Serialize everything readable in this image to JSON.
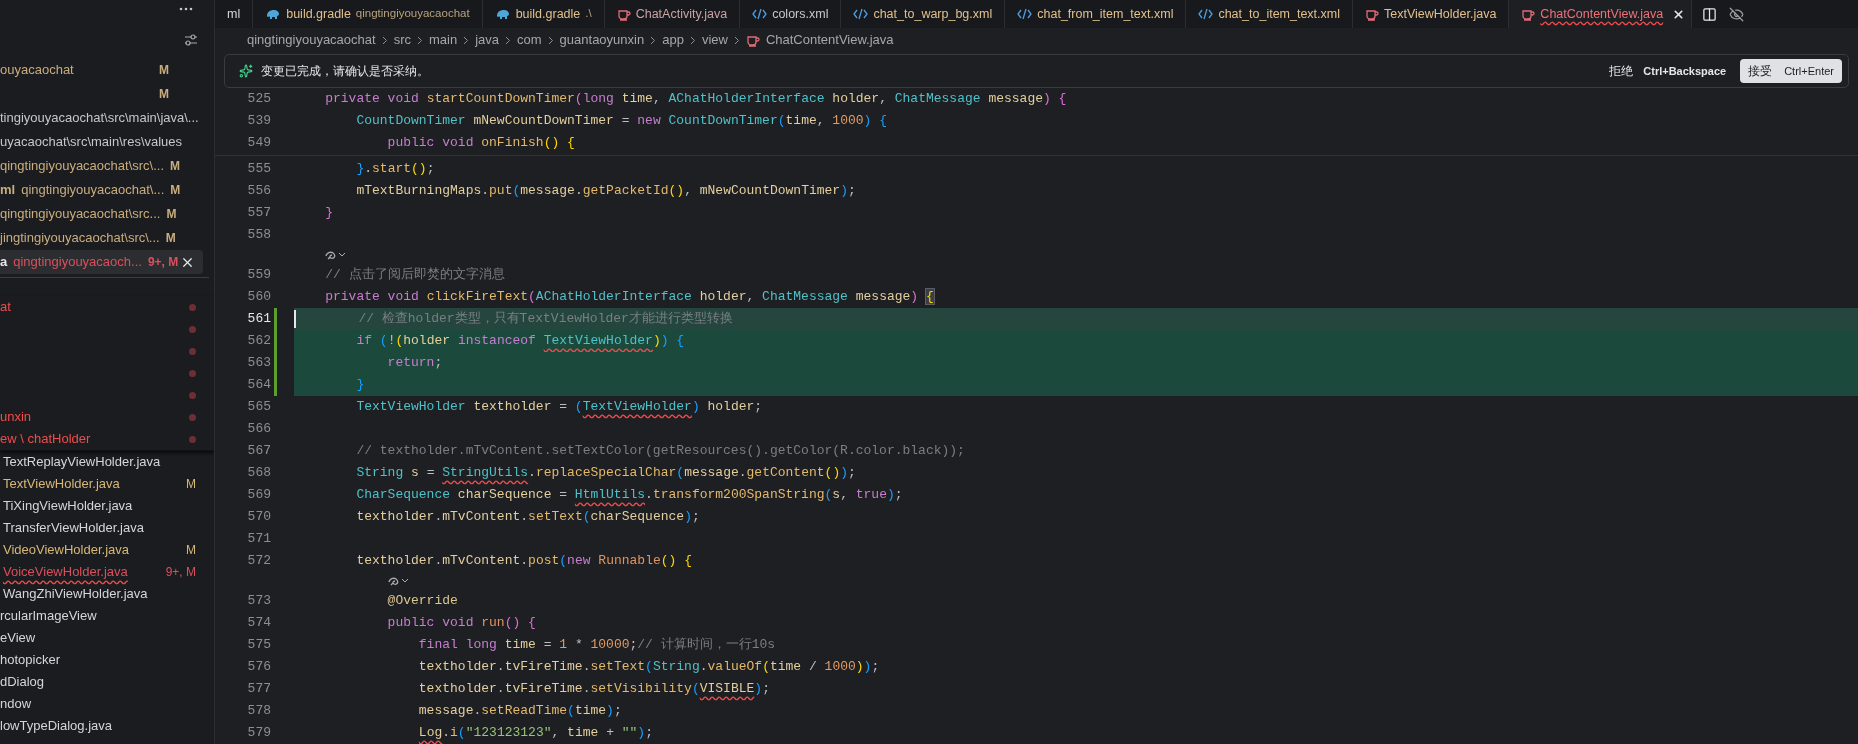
{
  "sidebar": {
    "editors": [
      {
        "path": "ouyacaochat",
        "badge": "M",
        "color": "#c9ad7f",
        "selected": false
      },
      {
        "badge": "M",
        "color": "#c9ad7f",
        "selected": false
      },
      {
        "path": "tingiyouyacaochat\\src\\main\\java\\...",
        "color": "#c5c7cb",
        "selected": false
      },
      {
        "path": "uyacaochat\\src\\main\\res\\values",
        "color": "#c5c7cb",
        "selected": false
      },
      {
        "path": "qingtingiyouyacaochat\\src\\...",
        "badge": "M",
        "color": "#c9ad7f",
        "selected": false
      },
      {
        "name": "ml",
        "path": "qingtingiyouyacaochat\\...",
        "badge": "M",
        "color": "#c9ad7f",
        "selected": false
      },
      {
        "path": "qingtingiyouyacaochat\\src...",
        "badge": "M",
        "color": "#c9ad7f",
        "selected": false
      },
      {
        "path": "jingtingiyouyacaochat\\src\\...",
        "badge": "M",
        "color": "#c9ad7f",
        "selected": false
      },
      {
        "name": "a",
        "path": "qingtingiyouyacaoch...",
        "badge": "9+, M",
        "color": "#d9505c",
        "selected": true
      }
    ],
    "tree": [
      {
        "label": "at",
        "color": "#f14c4c",
        "problem": true
      },
      {
        "problem": true
      },
      {
        "problem": true
      },
      {
        "problem": true
      },
      {
        "problem": true
      },
      {
        "label": "unxin",
        "color": "#f14c4c",
        "problem": true
      },
      {
        "label": "ew \\ chatHolder",
        "color": "#f14c4c",
        "problem": true,
        "children": [
          {
            "label": "TextReplayViewHolder.java",
            "color": "#d4d6da",
            "problem": false
          },
          {
            "label": "TextViewHolder.java",
            "color": "#d8b777",
            "badge": "M",
            "problem": false
          },
          {
            "label": "TiXingViewHolder.java",
            "color": "#d4d6da",
            "problem": false
          },
          {
            "label": "TransferViewHolder.java",
            "color": "#d4d6da",
            "problem": false
          },
          {
            "label": "VideoViewHolder.java",
            "color": "#d8b777",
            "badge": "M",
            "problem": false
          },
          {
            "label": "VoiceViewHolder.java",
            "color": "#d9505c",
            "badge": "9+, M",
            "problem": true
          },
          {
            "label": "WangZhiViewHolder.java",
            "color": "#d4d6da",
            "problem": false
          }
        ]
      },
      {
        "label": "rcularImageView",
        "color": "#d4d6da",
        "problem": false
      },
      {
        "label": "eView",
        "color": "#d4d6da",
        "problem": false
      },
      {
        "label": "hotopicker",
        "color": "#d4d6da",
        "problem": false
      },
      {
        "label": "dDialog",
        "color": "#d4d6da",
        "problem": false
      },
      {
        "label": "ndow",
        "color": "#d4d6da",
        "problem": false
      },
      {
        "label": "lowTypeDialog.java",
        "color": "#d4d6da",
        "problem": false
      }
    ]
  },
  "tabs": [
    {
      "label": "ml",
      "kind": "none",
      "color": "#d4d6da",
      "selected": false,
      "problem": false
    },
    {
      "label": "build.gradle",
      "detail": "qingtingiyouyacaochat",
      "kind": "gradle",
      "color": "#e2c08d",
      "selected": false,
      "problem": false
    },
    {
      "label": "build.gradle",
      "detail": ".\\",
      "kind": "gradle",
      "color": "#e2c08d",
      "selected": false,
      "problem": false
    },
    {
      "label": "ChatActivity.java",
      "kind": "java",
      "color": "#c9a3a6",
      "selected": false,
      "problem": false
    },
    {
      "label": "colors.xml",
      "kind": "xml",
      "color": "#c5c7cb",
      "selected": false,
      "problem": false
    },
    {
      "label": "chat_to_warp_bg.xml",
      "kind": "xml",
      "color": "#e2c08d",
      "selected": false,
      "problem": false
    },
    {
      "label": "chat_from_item_text.xml",
      "kind": "xml",
      "color": "#e2c08d",
      "selected": false,
      "problem": false
    },
    {
      "label": "chat_to_item_text.xml",
      "kind": "xml",
      "color": "#e2c08d",
      "selected": false,
      "problem": false
    },
    {
      "label": "TextViewHolder.java",
      "kind": "java",
      "color": "#e2c08d",
      "selected": false,
      "problem": false
    },
    {
      "label": "ChatContentView.java",
      "kind": "java",
      "color": "#f0707a",
      "selected": true,
      "problem": true
    }
  ],
  "breadcrumb": [
    "qingtingiyouyacaochat",
    "src",
    "main",
    "java",
    "com",
    "guantaoyunxin",
    "app",
    "view",
    "ChatContentView.java"
  ],
  "notice": {
    "message": "变更已完成，请确认是否采纳。",
    "reject": {
      "label": "拒绝",
      "shortcut": "Ctrl+Backspace"
    },
    "accept": {
      "label": "接受",
      "shortcut": "Ctrl+Enter"
    }
  },
  "sticky_lines": [
    {
      "num": "525",
      "tokens": [
        {
          "kind": "kw",
          "text": "    private void "
        },
        {
          "kind": "fn",
          "text": "startCountDownTimer"
        },
        {
          "kind": "b2",
          "text": "("
        },
        {
          "kind": "kw",
          "text": "long "
        },
        {
          "kind": "var",
          "text": "time"
        },
        {
          "kind": "p",
          "text": ", "
        },
        {
          "kind": "type",
          "text": "AChatHolderInterface "
        },
        {
          "kind": "var",
          "text": "holder"
        },
        {
          "kind": "p",
          "text": ", "
        },
        {
          "kind": "type",
          "text": "ChatMessage "
        },
        {
          "kind": "var",
          "text": "message"
        },
        {
          "kind": "b2",
          "text": ") "
        },
        {
          "kind": "b2",
          "text": "{"
        }
      ]
    },
    {
      "num": "539",
      "tokens": [
        {
          "kind": "type",
          "text": "        CountDownTimer "
        },
        {
          "kind": "var",
          "text": "mNewCountDownTimer"
        },
        {
          "kind": "p",
          "text": " = "
        },
        {
          "kind": "kw",
          "text": "new "
        },
        {
          "kind": "type",
          "text": "CountDownTimer"
        },
        {
          "kind": "b3",
          "text": "("
        },
        {
          "kind": "var",
          "text": "time"
        },
        {
          "kind": "p",
          "text": ", "
        },
        {
          "kind": "num",
          "text": "1000"
        },
        {
          "kind": "b3",
          "text": ") "
        },
        {
          "kind": "b3",
          "text": "{"
        }
      ]
    },
    {
      "num": "549",
      "tokens": [
        {
          "kind": "kw",
          "text": "            public void "
        },
        {
          "kind": "fn",
          "text": "onFinish"
        },
        {
          "kind": "b1",
          "text": "() "
        },
        {
          "kind": "b1",
          "text": "{"
        }
      ]
    }
  ],
  "lines": [
    {
      "kind": "code",
      "num": "555",
      "added": false,
      "current": false,
      "tokens": [
        {
          "kind": "b3",
          "text": "        }"
        },
        {
          "kind": "p",
          "text": "."
        },
        {
          "kind": "fn",
          "text": "start"
        },
        {
          "kind": "b1",
          "text": "()"
        },
        {
          "kind": "p",
          "text": ";"
        }
      ]
    },
    {
      "kind": "code",
      "num": "556",
      "added": false,
      "current": false,
      "tokens": [
        {
          "kind": "var",
          "text": "        mTextBurningMaps"
        },
        {
          "kind": "p",
          "text": "."
        },
        {
          "kind": "fn",
          "text": "put"
        },
        {
          "kind": "b3",
          "text": "("
        },
        {
          "kind": "var",
          "text": "message"
        },
        {
          "kind": "p",
          "text": "."
        },
        {
          "kind": "fn",
          "text": "getPacketId"
        },
        {
          "kind": "b1",
          "text": "()"
        },
        {
          "kind": "p",
          "text": ", "
        },
        {
          "kind": "var",
          "text": "mNewCountDownTimer"
        },
        {
          "kind": "b3",
          "text": ")"
        },
        {
          "kind": "p",
          "text": ";"
        }
      ]
    },
    {
      "kind": "code",
      "num": "557",
      "added": false,
      "current": false,
      "tokens": [
        {
          "kind": "b2",
          "text": "    }"
        }
      ]
    },
    {
      "kind": "code",
      "num": "558",
      "added": false,
      "current": false
    },
    {
      "kind": "lens"
    },
    {
      "kind": "code",
      "num": "559",
      "added": false,
      "current": false,
      "tokens": [
        {
          "kind": "cm",
          "text": "    // 点击了阅后即焚的文字消息"
        }
      ]
    },
    {
      "kind": "code",
      "num": "560",
      "added": false,
      "current": false,
      "tokens": [
        {
          "kind": "kw",
          "text": "    private void "
        },
        {
          "kind": "fn",
          "text": "clickFireText"
        },
        {
          "kind": "b2",
          "text": "("
        },
        {
          "kind": "type",
          "text": "AChatHolderInterface "
        },
        {
          "kind": "var",
          "text": "holder"
        },
        {
          "kind": "p",
          "text": ", "
        },
        {
          "kind": "type",
          "text": "ChatMessage "
        },
        {
          "kind": "var",
          "text": "message"
        },
        {
          "kind": "b2",
          "text": ") "
        },
        {
          "kind": "match",
          "text": "{"
        }
      ]
    },
    {
      "kind": "code",
      "num": "561",
      "added": true,
      "current": true,
      "tokens": [
        {
          "kind": "cm",
          "text": "        // 检查holder类型，只有TextViewHolder才能进行类型转换"
        }
      ]
    },
    {
      "kind": "code",
      "num": "562",
      "added": true,
      "current": false,
      "tokens": [
        {
          "kind": "kw",
          "text": "        if "
        },
        {
          "kind": "b3",
          "text": "("
        },
        {
          "kind": "p",
          "text": "!"
        },
        {
          "kind": "b1",
          "text": "("
        },
        {
          "kind": "var",
          "text": "holder "
        },
        {
          "kind": "kw",
          "text": "instanceof "
        },
        {
          "kind": "type_err",
          "text": "TextViewHolder"
        },
        {
          "kind": "b1",
          "text": ")"
        },
        {
          "kind": "b3",
          "text": ") "
        },
        {
          "kind": "b3",
          "text": "{"
        }
      ]
    },
    {
      "kind": "code",
      "num": "563",
      "added": true,
      "current": false,
      "tokens": [
        {
          "kind": "kw",
          "text": "            return"
        },
        {
          "kind": "p",
          "text": ";"
        }
      ]
    },
    {
      "kind": "code",
      "num": "564",
      "added": true,
      "current": false,
      "tokens": [
        {
          "kind": "b3",
          "text": "        }"
        }
      ]
    },
    {
      "kind": "code",
      "num": "565",
      "added": false,
      "current": false,
      "tokens": [
        {
          "kind": "type",
          "text": "        TextViewHolder "
        },
        {
          "kind": "var",
          "text": "textholder"
        },
        {
          "kind": "p",
          "text": " = "
        },
        {
          "kind": "b3",
          "text": "("
        },
        {
          "kind": "type_err",
          "text": "TextViewHolder"
        },
        {
          "kind": "b3",
          "text": ") "
        },
        {
          "kind": "var",
          "text": "holder"
        },
        {
          "kind": "p",
          "text": ";"
        }
      ]
    },
    {
      "kind": "code",
      "num": "566",
      "added": false,
      "current": false
    },
    {
      "kind": "code",
      "num": "567",
      "added": false,
      "current": false,
      "tokens": [
        {
          "kind": "cm",
          "text": "        // textholder.mTvContent.setTextColor(getResources().getColor(R.color.black));"
        }
      ]
    },
    {
      "kind": "code",
      "num": "568",
      "added": false,
      "current": false,
      "tokens": [
        {
          "kind": "type",
          "text": "        String "
        },
        {
          "kind": "var",
          "text": "s"
        },
        {
          "kind": "p",
          "text": " = "
        },
        {
          "kind": "type_err",
          "text": "StringUtils"
        },
        {
          "kind": "p",
          "text": "."
        },
        {
          "kind": "fn",
          "text": "replaceSpecialChar"
        },
        {
          "kind": "b3",
          "text": "("
        },
        {
          "kind": "var",
          "text": "message"
        },
        {
          "kind": "p",
          "text": "."
        },
        {
          "kind": "fn",
          "text": "getContent"
        },
        {
          "kind": "b1",
          "text": "()"
        },
        {
          "kind": "b3",
          "text": ")"
        },
        {
          "kind": "p",
          "text": ";"
        }
      ]
    },
    {
      "kind": "code",
      "num": "569",
      "added": false,
      "current": false,
      "tokens": [
        {
          "kind": "type",
          "text": "        CharSequence "
        },
        {
          "kind": "var",
          "text": "charSequence"
        },
        {
          "kind": "p",
          "text": " = "
        },
        {
          "kind": "type_err",
          "text": "HtmlUtils"
        },
        {
          "kind": "p",
          "text": "."
        },
        {
          "kind": "fn",
          "text": "transform200SpanString"
        },
        {
          "kind": "b3",
          "text": "("
        },
        {
          "kind": "var",
          "text": "s"
        },
        {
          "kind": "p",
          "text": ", "
        },
        {
          "kind": "kw",
          "text": "true"
        },
        {
          "kind": "b3",
          "text": ")"
        },
        {
          "kind": "p",
          "text": ";"
        }
      ]
    },
    {
      "kind": "code",
      "num": "570",
      "added": false,
      "current": false,
      "tokens": [
        {
          "kind": "var",
          "text": "        textholder"
        },
        {
          "kind": "p",
          "text": "."
        },
        {
          "kind": "var",
          "text": "mTvContent"
        },
        {
          "kind": "p",
          "text": "."
        },
        {
          "kind": "fn",
          "text": "setText"
        },
        {
          "kind": "b3",
          "text": "("
        },
        {
          "kind": "var",
          "text": "charSequence"
        },
        {
          "kind": "b3",
          "text": ")"
        },
        {
          "kind": "p",
          "text": ";"
        }
      ]
    },
    {
      "kind": "code",
      "num": "571",
      "added": false,
      "current": false
    },
    {
      "kind": "code",
      "num": "572",
      "added": false,
      "current": false,
      "tokens": [
        {
          "kind": "var",
          "text": "        textholder"
        },
        {
          "kind": "p",
          "text": "."
        },
        {
          "kind": "var",
          "text": "mTvContent"
        },
        {
          "kind": "p",
          "text": "."
        },
        {
          "kind": "fn",
          "text": "post"
        },
        {
          "kind": "b3",
          "text": "("
        },
        {
          "kind": "kw",
          "text": "new "
        },
        {
          "kind": "cls",
          "text": "Runnable"
        },
        {
          "kind": "b1",
          "text": "() "
        },
        {
          "kind": "b1",
          "text": "{"
        }
      ]
    },
    {
      "kind": "lens"
    },
    {
      "kind": "code",
      "num": "573",
      "added": false,
      "current": false,
      "tokens": [
        {
          "kind": "ann",
          "text": "            @Override"
        }
      ]
    },
    {
      "kind": "code",
      "num": "574",
      "added": false,
      "current": false,
      "tokens": [
        {
          "kind": "kw",
          "text": "            public void "
        },
        {
          "kind": "cls",
          "text": "run"
        },
        {
          "kind": "b2",
          "text": "() "
        },
        {
          "kind": "b2",
          "text": "{"
        }
      ]
    },
    {
      "kind": "code",
      "num": "575",
      "added": false,
      "current": false,
      "tokens": [
        {
          "kind": "kw",
          "text": "                final long "
        },
        {
          "kind": "var",
          "text": "time"
        },
        {
          "kind": "p",
          "text": " = "
        },
        {
          "kind": "num",
          "text": "1"
        },
        {
          "kind": "p",
          "text": " * "
        },
        {
          "kind": "num",
          "text": "10000"
        },
        {
          "kind": "p",
          "text": ";"
        },
        {
          "kind": "cm",
          "text": "// 计算时间，一行10s"
        }
      ]
    },
    {
      "kind": "code",
      "num": "576",
      "added": false,
      "current": false,
      "tokens": [
        {
          "kind": "var",
          "text": "                textholder"
        },
        {
          "kind": "p",
          "text": "."
        },
        {
          "kind": "var",
          "text": "tvFireTime"
        },
        {
          "kind": "p",
          "text": "."
        },
        {
          "kind": "fn",
          "text": "setText"
        },
        {
          "kind": "b3",
          "text": "("
        },
        {
          "kind": "type",
          "text": "String"
        },
        {
          "kind": "p",
          "text": "."
        },
        {
          "kind": "fn",
          "text": "valueOf"
        },
        {
          "kind": "b1",
          "text": "("
        },
        {
          "kind": "var",
          "text": "time"
        },
        {
          "kind": "p",
          "text": " / "
        },
        {
          "kind": "num",
          "text": "1000"
        },
        {
          "kind": "b1",
          "text": ")"
        },
        {
          "kind": "b3",
          "text": ")"
        },
        {
          "kind": "p",
          "text": ";"
        }
      ]
    },
    {
      "kind": "code",
      "num": "577",
      "added": false,
      "current": false,
      "tokens": [
        {
          "kind": "var",
          "text": "                textholder"
        },
        {
          "kind": "p",
          "text": "."
        },
        {
          "kind": "var",
          "text": "tvFireTime"
        },
        {
          "kind": "p",
          "text": "."
        },
        {
          "kind": "fn",
          "text": "setVisibility"
        },
        {
          "kind": "b3",
          "text": "("
        },
        {
          "kind": "var_err",
          "text": "VISIBLE"
        },
        {
          "kind": "b3",
          "text": ")"
        },
        {
          "kind": "p",
          "text": ";"
        }
      ]
    },
    {
      "kind": "code",
      "num": "578",
      "added": false,
      "current": false,
      "tokens": [
        {
          "kind": "var",
          "text": "                message"
        },
        {
          "kind": "p",
          "text": "."
        },
        {
          "kind": "fn",
          "text": "setReadTime"
        },
        {
          "kind": "b3",
          "text": "("
        },
        {
          "kind": "var",
          "text": "time"
        },
        {
          "kind": "b3",
          "text": ")"
        },
        {
          "kind": "p",
          "text": ";"
        }
      ]
    },
    {
      "kind": "code",
      "num": "579",
      "added": false,
      "current": false,
      "tokens": [
        {
          "kind": "var_err",
          "text": "                Log"
        },
        {
          "kind": "p",
          "text": "."
        },
        {
          "kind": "fn",
          "text": "i"
        },
        {
          "kind": "b3",
          "text": "("
        },
        {
          "kind": "str",
          "text": "\"123123123\""
        },
        {
          "kind": "p",
          "text": ", "
        },
        {
          "kind": "var",
          "text": "time"
        },
        {
          "kind": "p",
          "text": " + "
        },
        {
          "kind": "str",
          "text": "\"\""
        },
        {
          "kind": "b3",
          "text": ")"
        },
        {
          "kind": "p",
          "text": ";"
        }
      ]
    }
  ]
}
